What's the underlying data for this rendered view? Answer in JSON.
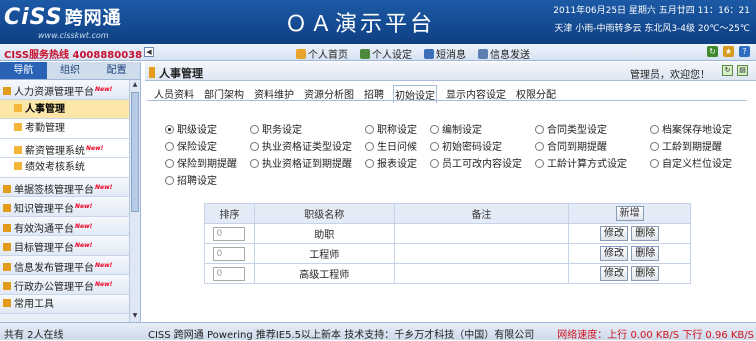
{
  "banner": {
    "logo": "CiSS",
    "logo_cn": "跨网通",
    "logo_url": "www.cisskwt.com",
    "title": "ＯＡ演示平台",
    "date": "2011年06月25日  星期六  五月廿四  11：16：21",
    "weather": "天津   小雨-中雨转多云  东北风3-4级  20℃～25℃"
  },
  "toolbar": {
    "hotline": "CISS服务热线  4008880038",
    "collapse": "◀",
    "links": [
      "个人首页",
      "个人设定",
      "短消息",
      "信息发送"
    ]
  },
  "sidebar": {
    "tabs": [
      "导航",
      "组织",
      "配置"
    ],
    "items": [
      {
        "label": "人力资源管理平台",
        "new": true,
        "sub": false,
        "active": false
      },
      {
        "label": "人事管理",
        "new": false,
        "sub": true,
        "active": true
      },
      {
        "label": "考勤管理",
        "new": false,
        "sub": true,
        "active": false
      },
      {
        "label": "薪资管理系统",
        "new": true,
        "sub": true,
        "active": false
      },
      {
        "label": "绩效考核系统",
        "new": false,
        "sub": true,
        "active": false
      },
      {
        "label": "单据签核管理平台",
        "new": true,
        "sub": false,
        "active": false
      },
      {
        "label": "知识管理平台",
        "new": true,
        "sub": false,
        "active": false
      },
      {
        "label": "有效沟通平台",
        "new": true,
        "sub": false,
        "active": false
      },
      {
        "label": "目标管理平台",
        "new": true,
        "sub": false,
        "active": false
      },
      {
        "label": "信息发布管理平台",
        "new": true,
        "sub": false,
        "active": false
      },
      {
        "label": "行政办公管理平台",
        "new": true,
        "sub": false,
        "active": false
      },
      {
        "label": "常用工具",
        "new": false,
        "sub": false,
        "active": false
      }
    ],
    "new_tag": "New!"
  },
  "main": {
    "title": "人事管理",
    "welcome": "管理员，欢迎您！",
    "tabs": [
      "人员资料",
      "部门架构",
      "资料维护",
      "资源分析图",
      "招聘",
      "初始设定",
      "显示内容设定",
      "权限分配"
    ],
    "active_tab": "初始设定",
    "options": [
      {
        "label": "职级设定",
        "checked": true
      },
      {
        "label": "职务设定",
        "checked": false
      },
      {
        "label": "职称设定",
        "checked": false
      },
      {
        "label": "编制设定",
        "checked": false
      },
      {
        "label": "合同类型设定",
        "checked": false
      },
      {
        "label": "档案保存地设定",
        "checked": false
      },
      {
        "label": "保险设定",
        "checked": false
      },
      {
        "label": "执业资格证类型设定",
        "checked": false
      },
      {
        "label": "生日问候",
        "checked": false
      },
      {
        "label": "初始密码设定",
        "checked": false
      },
      {
        "label": "合同到期提醒",
        "checked": false
      },
      {
        "label": "工龄到期提醒",
        "checked": false
      },
      {
        "label": "保险到期提醒",
        "checked": false
      },
      {
        "label": "执业资格证到期提醒",
        "checked": false
      },
      {
        "label": "报表设定",
        "checked": false
      },
      {
        "label": "员工可改内容设定",
        "checked": false
      },
      {
        "label": "工龄计算方式设定",
        "checked": false
      },
      {
        "label": "自定义栏位设定",
        "checked": false
      },
      {
        "label": "招聘设定",
        "checked": false
      }
    ],
    "table": {
      "headers": [
        "排序",
        "职级名称",
        "备注"
      ],
      "add_button": "新增",
      "edit_button": "修改",
      "delete_button": "删除",
      "rows": [
        {
          "order": "0",
          "name": "助职",
          "note": ""
        },
        {
          "order": "0",
          "name": "工程师",
          "note": ""
        },
        {
          "order": "0",
          "name": "高级工程师",
          "note": ""
        }
      ]
    }
  },
  "footer": {
    "online": "共有  2人在线",
    "center": "CISS 跨网通 Powering    推荐IE5.5以上新本    技术支持：千乡万才科技（中国）有限公司",
    "speed": "网络速度：上行  0.00 KB/S  下行  0.96 KB/S"
  }
}
